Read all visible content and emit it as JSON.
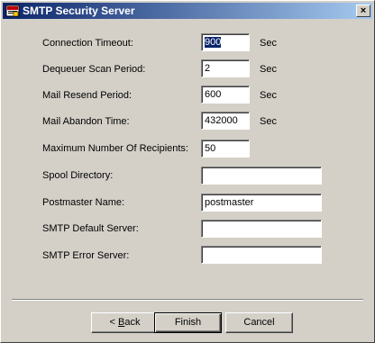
{
  "window": {
    "title": "SMTP Security Server",
    "close_label": "×"
  },
  "fields": [
    {
      "label": "Connection Timeout:",
      "value": "900",
      "unit": "Sec"
    },
    {
      "label": "Dequeuer Scan Period:",
      "value": "2",
      "unit": "Sec"
    },
    {
      "label": "Mail Resend Period:",
      "value": "600",
      "unit": "Sec"
    },
    {
      "label": "Mail Abandon Time:",
      "value": "432000",
      "unit": "Sec"
    },
    {
      "label": "Maximum Number Of Recipients:",
      "value": "50"
    },
    {
      "label": "Spool Directory:",
      "value": ""
    },
    {
      "label": "Postmaster Name:",
      "value": "postmaster"
    },
    {
      "label": "SMTP Default Server:",
      "value": ""
    },
    {
      "label": "SMTP Error Server:",
      "value": ""
    }
  ],
  "buttons": {
    "back_prefix": "< ",
    "back_mnemonic": "B",
    "back_rest": "ack",
    "finish": "Finish",
    "cancel": "Cancel"
  }
}
